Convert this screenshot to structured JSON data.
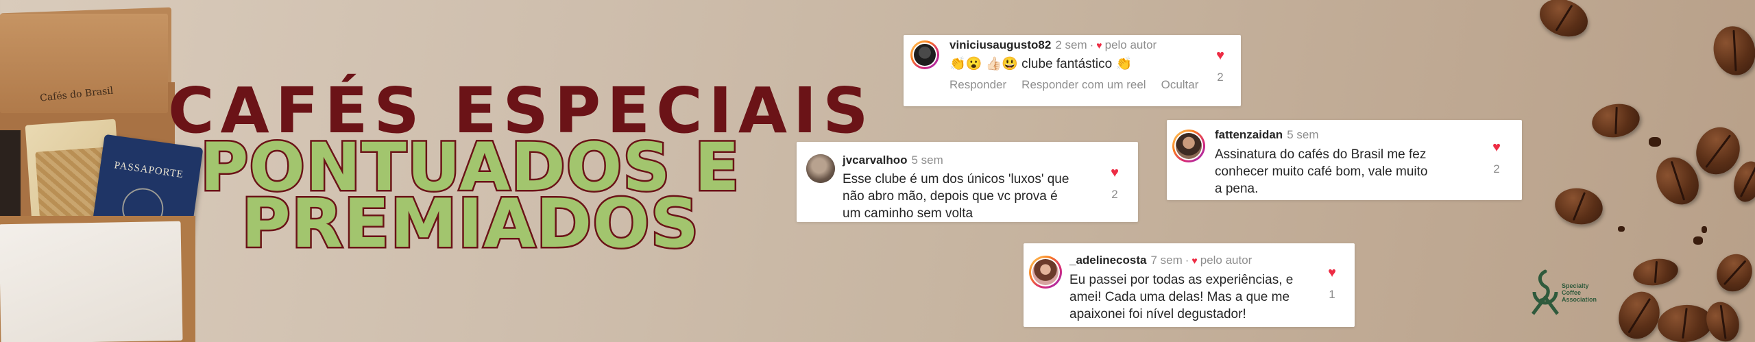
{
  "box": {
    "flap_text": "Cafés do Brasil",
    "passport_label": "PASSAPORTE"
  },
  "headline": {
    "line1": "CAFÉS ESPECIAIS",
    "line2": "PONTUADOS E",
    "line3": "PREMIADOS"
  },
  "comments": [
    {
      "user": "viniciusaugusto82",
      "time": "2 sem",
      "by_author": "pelo autor",
      "text": "👏😮 👍🏻😃 clube fantástico 👏",
      "likes": "2",
      "actions": [
        "Responder",
        "Responder com um reel",
        "Ocultar"
      ]
    },
    {
      "user": "jvcarvalhoo",
      "time": "5 sem",
      "text_lines": [
        "Esse clube é um dos únicos 'luxos' que",
        "não abro mão, depois que vc prova é",
        "um caminho sem volta"
      ],
      "likes": "2"
    },
    {
      "user": "fattenzaidan",
      "time": "5 sem",
      "text_lines": [
        "Assinatura do cafés do Brasil me fez",
        "conhecer muito café bom,  vale muito",
        "a pena."
      ],
      "likes": "2"
    },
    {
      "user": "_adelinecosta",
      "time": "7 sem",
      "by_author": "pelo autor",
      "text_lines": [
        "Eu passei por todas as experiências, e",
        "amei! Cada uma delas! Mas a que me",
        "apaixonei foi nível degustador!"
      ],
      "likes": "1"
    }
  ],
  "logo": {
    "line1": "Specialty",
    "line2": "Coffee",
    "line3": "Association"
  },
  "colors": {
    "headline_dark": "#6b1317",
    "headline_green": "#a2c56e",
    "heart": "#ed2c44",
    "muted": "#8e8e8e"
  },
  "icons": [
    "heart-icon",
    "small-heart-icon",
    "coffee-bean",
    "sca-logo-icon"
  ]
}
